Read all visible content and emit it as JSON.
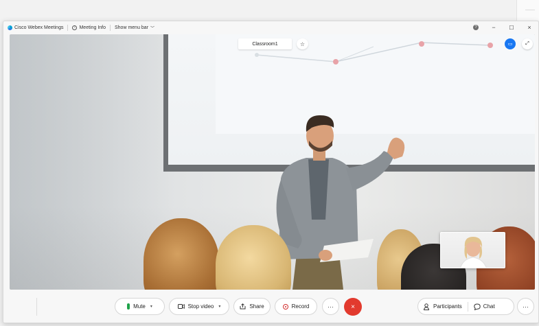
{
  "titlebar": {
    "app_name": "Cisco Webex Meetings",
    "meeting_info": "Meeting Info",
    "show_menu": "Show menu bar",
    "minimize": "−",
    "maximize": "☐",
    "close": "×",
    "help": "?"
  },
  "stage": {
    "meeting_name": "Classroom1"
  },
  "controls": {
    "mute": "Mute",
    "stop_video": "Stop video",
    "share": "Share",
    "record": "Record",
    "more": "···",
    "end": "×",
    "participants": "Participants",
    "chat": "Chat",
    "panel_more": "···"
  },
  "colors": {
    "accent": "#1877f2",
    "end_call": "#e23a2e",
    "mic_on": "#1fa34a",
    "record": "#d32f2f"
  }
}
